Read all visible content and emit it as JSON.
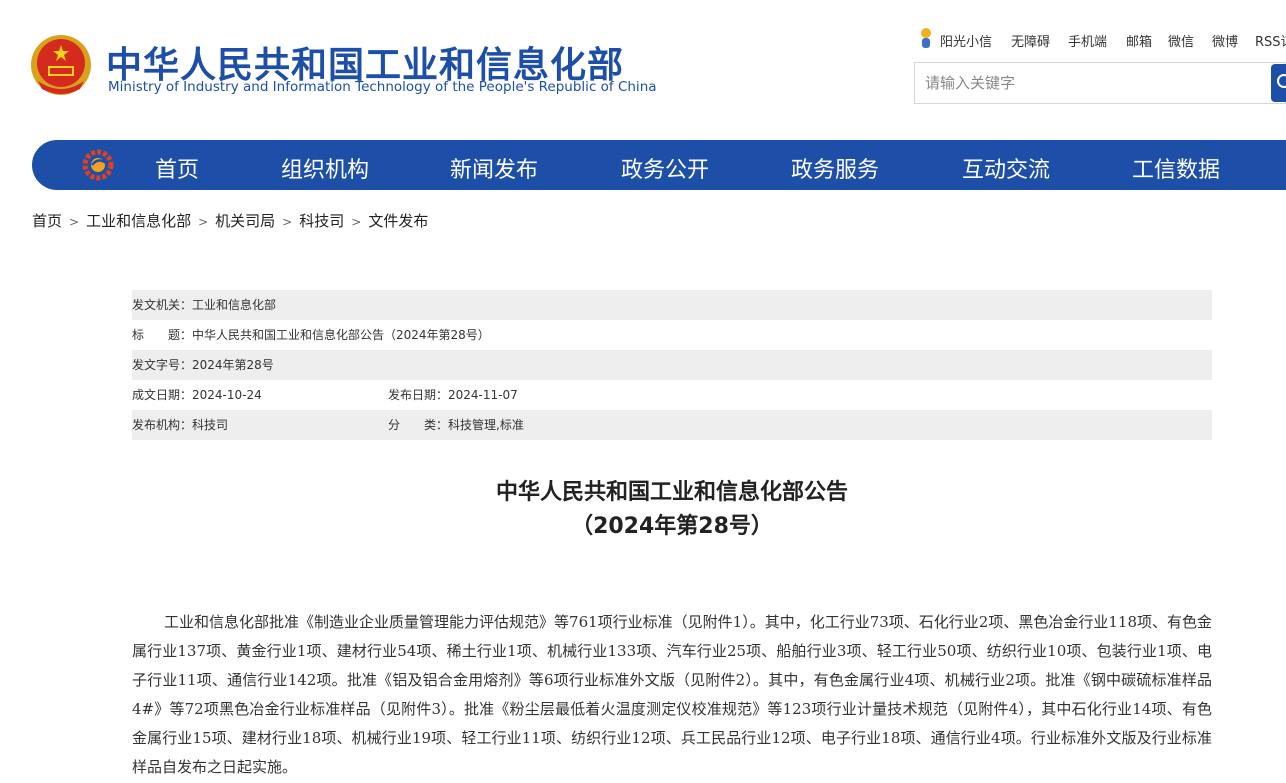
{
  "header": {
    "site_title": "中华人民共和国工业和信息化部",
    "site_subtitle": "Ministry of Industry and Information Technology of the People's Republic of China",
    "top_links": [
      "阳光小信",
      "无障碍",
      "手机端",
      "邮箱",
      "微信",
      "微博",
      "RSS订阅"
    ],
    "search_placeholder": "请输入关键字",
    "brand_color": "#1e4fa8"
  },
  "nav": {
    "items": [
      "首页",
      "组织机构",
      "新闻发布",
      "政务公开",
      "政务服务",
      "互动交流",
      "工信数据"
    ]
  },
  "breadcrumb": [
    "首页",
    "工业和信息化部",
    "机关司局",
    "科技司",
    "文件发布"
  ],
  "meta": {
    "issuer": "发文机关：工业和信息化部",
    "title": "标　　题：中华人民共和国工业和信息化部公告（2024年第28号）",
    "doc_number": "发文字号：2024年第28号",
    "written_date": "成文日期：2024-10-24",
    "publish_date": "发布日期：2024-11-07",
    "publisher": "发布机构：科技司",
    "category": "分　　类：科技管理,标准"
  },
  "article": {
    "title_line1": "中华人民共和国工业和信息化部公告",
    "title_line2": "（2024年第28号）",
    "body": "工业和信息化部批准《制造业企业质量管理能力评估规范》等761项行业标准（见附件1）。其中，化工行业73项、石化行业2项、黑色冶金行业118项、有色金属行业137项、黄金行业1项、建材行业54项、稀土行业1项、机械行业133项、汽车行业25项、船舶行业3项、轻工行业50项、纺织行业10项、包装行业1项、电子行业11项、通信行业142项。批准《铝及铝合金用熔剂》等6项行业标准外文版（见附件2）。其中，有色金属行业4项、机械行业2项。批准《钢中碳硫标准样品4#》等72项黑色冶金行业标准样品（见附件3）。批准《粉尘层最低着火温度测定仪校准规范》等123项行业计量技术规范（见附件4），其中石化行业14项、有色金属行业15项、建材行业18项、机械行业19项、轻工行业11项、纺织行业12项、兵工民品行业12项、电子行业18项、通信行业4项。行业标准外文版及行业标准样品自发布之日起实施。"
  }
}
